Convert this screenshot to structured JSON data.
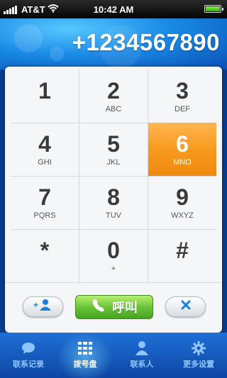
{
  "status_bar": {
    "carrier": "AT&T",
    "time": "10:42 AM",
    "battery_level": 1.0
  },
  "display": {
    "number": "+1234567890"
  },
  "keypad": [
    {
      "digit": "1",
      "letters": ""
    },
    {
      "digit": "2",
      "letters": "ABC"
    },
    {
      "digit": "3",
      "letters": "DEF"
    },
    {
      "digit": "4",
      "letters": "GHI"
    },
    {
      "digit": "5",
      "letters": "JKL"
    },
    {
      "digit": "6",
      "letters": "MNO"
    },
    {
      "digit": "7",
      "letters": "PQRS"
    },
    {
      "digit": "8",
      "letters": "TUV"
    },
    {
      "digit": "9",
      "letters": "WXYZ"
    },
    {
      "digit": "*",
      "letters": ""
    },
    {
      "digit": "0",
      "letters": "+"
    },
    {
      "digit": "#",
      "letters": ""
    }
  ],
  "active_key": "6",
  "actions": {
    "add_contact_icon": "add-contact-icon",
    "call_label": "呼叫",
    "delete_icon": "close-icon"
  },
  "nav": [
    {
      "label": "联系记录",
      "icon": "chat-bubble-icon"
    },
    {
      "label": "拨号盘",
      "icon": "keypad-grid-icon"
    },
    {
      "label": "联系人",
      "icon": "person-icon"
    },
    {
      "label": "更多设置",
      "icon": "gear-icon"
    }
  ],
  "active_nav": "拨号盘",
  "colors": {
    "accent_orange": "#f79a1f",
    "call_green": "#6ac43a",
    "nav_blue": "#1f6fd6"
  }
}
